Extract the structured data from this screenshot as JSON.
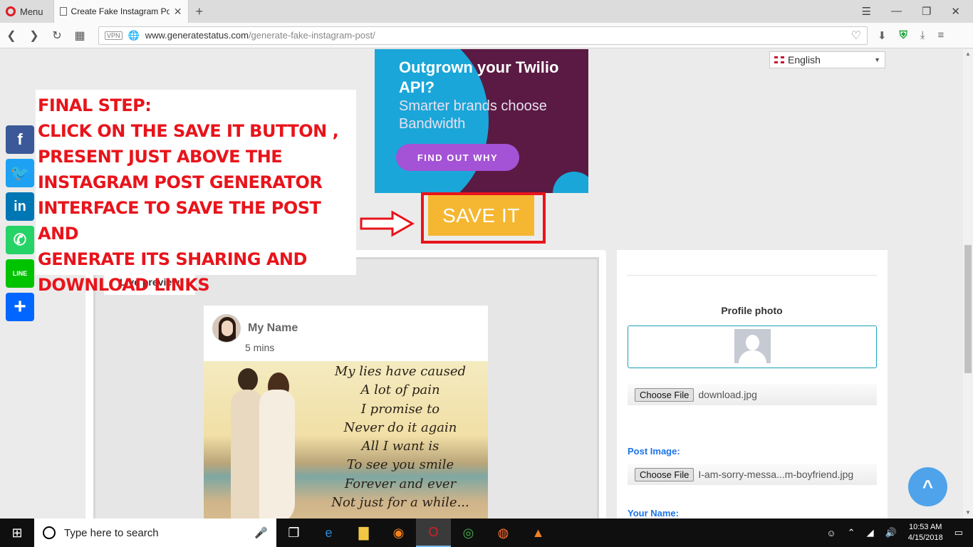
{
  "browser": {
    "menu_label": "Menu",
    "tab_title": "Create Fake Instagram Pos",
    "tab_close": "✕",
    "new_tab": "+",
    "vpn_badge": "VPN",
    "url_domain": "www.generatestatus.com",
    "url_path": "/generate-fake-instagram-post/"
  },
  "page": {
    "language": "English",
    "ad": {
      "title": "Outgrown your Twilio API?",
      "subtitle": "Smarter brands choose Bandwidth",
      "button": "FIND OUT WHY"
    },
    "instruction_lines": [
      "FINAL STEP:",
      "CLICK ON THE SAVE IT BUTTON ,",
      "PRESENT JUST ABOVE THE",
      "INSTAGRAM POST GENERATOR",
      "INTERFACE TO SAVE THE POST AND",
      "GENERATE ITS SHARING AND",
      "DOWNLOAD LINKS"
    ],
    "save_button": "SAVE IT",
    "social": [
      "f",
      "🐦",
      "in",
      "✆",
      "LINE",
      "+"
    ],
    "live_preview_tab": "Live preview",
    "post": {
      "name": "My Name",
      "time": "5 mins",
      "poem_lines": [
        "My lies have caused",
        "A lot of pain",
        "I promise to",
        "Never do it again",
        "All I want is",
        "To see you smile",
        "Forever and ever",
        "Not just for a while..."
      ]
    },
    "form": {
      "profile_photo_label": "Profile photo",
      "choose_file": "Choose File",
      "profile_file": "download.jpg",
      "post_image_label": "Post Image:",
      "post_image_file": "I-am-sorry-messa...m-boyfriend.jpg",
      "your_name_label": "Your Name:"
    },
    "scroll_up": "^"
  },
  "taskbar": {
    "search_placeholder": "Type here to search",
    "time": "10:53 AM",
    "date": "4/15/2018"
  },
  "colors": {
    "instruction_red": "#e8141b",
    "save_orange": "#f5b731",
    "ad_purple": "#5a1a43"
  }
}
